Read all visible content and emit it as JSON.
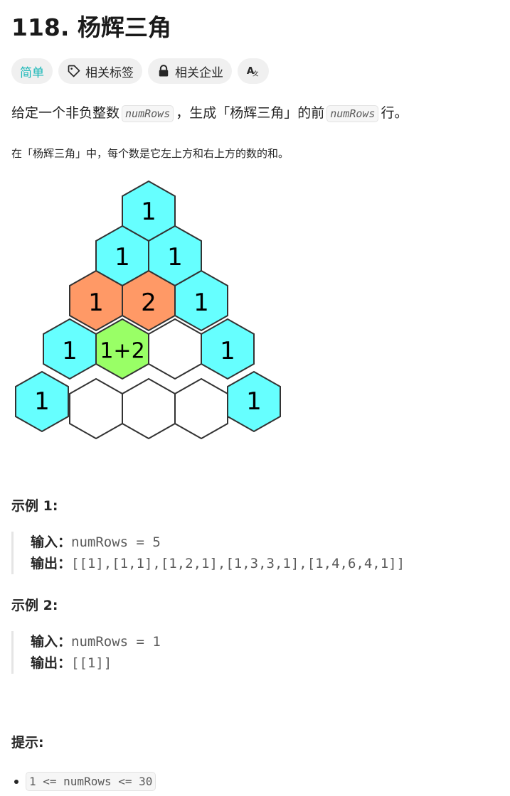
{
  "problem": {
    "title": "118. 杨辉三角"
  },
  "tags": {
    "difficulty": "简单",
    "related_tags": "相关标签",
    "related_companies": "相关企业",
    "translate_icon_text": "A文"
  },
  "description": {
    "part1": "给定一个非负整数",
    "code1": "numRows",
    "part2": "，生成「杨辉三角」的前",
    "code2": "numRows",
    "part3": "行。",
    "line2": "在「杨辉三角」中，每个数是它左上方和右上方的数的和。"
  },
  "triangle": {
    "colors": {
      "cyan": "#66ffff",
      "orange": "#ff9966",
      "green": "#99ff66",
      "white": "#ffffff"
    },
    "labels": [
      "1",
      "1",
      "1",
      "1",
      "2",
      "1",
      "1",
      "1+2",
      "1",
      "1",
      "1"
    ]
  },
  "examples": [
    {
      "title": "示例 1:",
      "input_label": "输入：",
      "input_value": "numRows = 5",
      "output_label": "输出：",
      "output_value": "[[1],[1,1],[1,2,1],[1,3,3,1],[1,4,6,4,1]]"
    },
    {
      "title": "示例 2:",
      "input_label": "输入：",
      "input_value": "numRows = 1",
      "output_label": "输出：",
      "output_value": "[[1]]"
    }
  ],
  "hints": {
    "title": "提示:",
    "items": [
      "1 <= numRows <= 30"
    ]
  }
}
